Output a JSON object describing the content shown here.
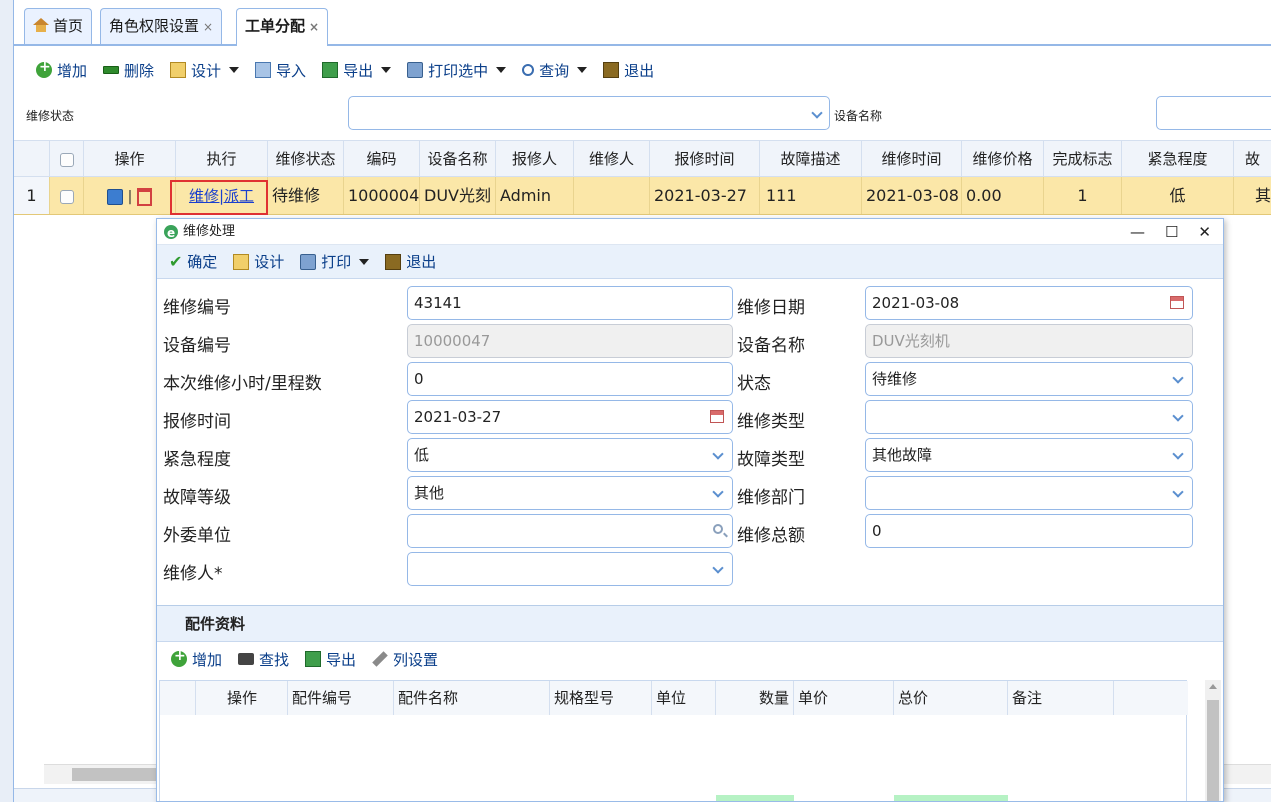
{
  "tabs": [
    {
      "label": "首页",
      "icon": "home-icon"
    },
    {
      "label": "角色权限设置",
      "close": "×"
    },
    {
      "label": "工单分配",
      "close": "×"
    }
  ],
  "toolbar": {
    "add": "增加",
    "delete": "删除",
    "design": "设计",
    "import": "导入",
    "export": "导出",
    "print_selected": "打印选中",
    "query": "查询",
    "exit": "退出"
  },
  "filter": {
    "status_label": "维修状态",
    "device_label": "设备名称"
  },
  "grid": {
    "columns": [
      "操作",
      "执行",
      "维修状态",
      "编码",
      "设备名称",
      "报修人",
      "维修人",
      "报修时间",
      "故障描述",
      "维修时间",
      "维修价格",
      "完成标志",
      "紧急程度",
      "故"
    ],
    "row": {
      "index": "1",
      "exec_link": "维修|派工",
      "status": "待维修",
      "code": "1000004",
      "device": "DUV光刻",
      "reporter": "Admin",
      "repairer": "",
      "report_time": "2021-03-27",
      "fault_desc": "111",
      "repair_time": "2021-03-08",
      "price": "0.00",
      "done_flag": "1",
      "urgency": "低",
      "extra": "其"
    }
  },
  "dialog": {
    "title": "维修处理",
    "toolbar": {
      "ok": "确定",
      "design": "设计",
      "print": "打印",
      "exit": "退出"
    },
    "window_buttons": {
      "min": "—",
      "max": "☐",
      "close": "✕"
    },
    "fields": {
      "repair_no": {
        "label": "维修编号",
        "value": "43141"
      },
      "repair_date": {
        "label": "维修日期",
        "value": "2021-03-08"
      },
      "device_no": {
        "label": "设备编号",
        "value": "10000047"
      },
      "device_name": {
        "label": "设备名称",
        "value": "DUV光刻机"
      },
      "hours": {
        "label": "本次维修小时/里程数",
        "value": "0"
      },
      "status": {
        "label": "状态",
        "value": "待维修"
      },
      "report_time": {
        "label": "报修时间",
        "value": "2021-03-27"
      },
      "repair_type": {
        "label": "维修类型",
        "value": ""
      },
      "urgency": {
        "label": "紧急程度",
        "value": "低"
      },
      "fault_type": {
        "label": "故障类型",
        "value": "其他故障"
      },
      "fault_level": {
        "label": "故障等级",
        "value": "其他"
      },
      "dept": {
        "label": "维修部门",
        "value": ""
      },
      "outsource": {
        "label": "外委单位",
        "value": ""
      },
      "total": {
        "label": "维修总额",
        "value": "0"
      },
      "repairer": {
        "label": "维修人*",
        "value": ""
      }
    },
    "parts": {
      "title": "配件资料",
      "toolbar": {
        "add": "增加",
        "find": "查找",
        "export": "导出",
        "columns": "列设置"
      },
      "columns": [
        "操作",
        "配件编号",
        "配件名称",
        "规格型号",
        "单位",
        "数量",
        "单价",
        "总价",
        "备注"
      ]
    }
  }
}
